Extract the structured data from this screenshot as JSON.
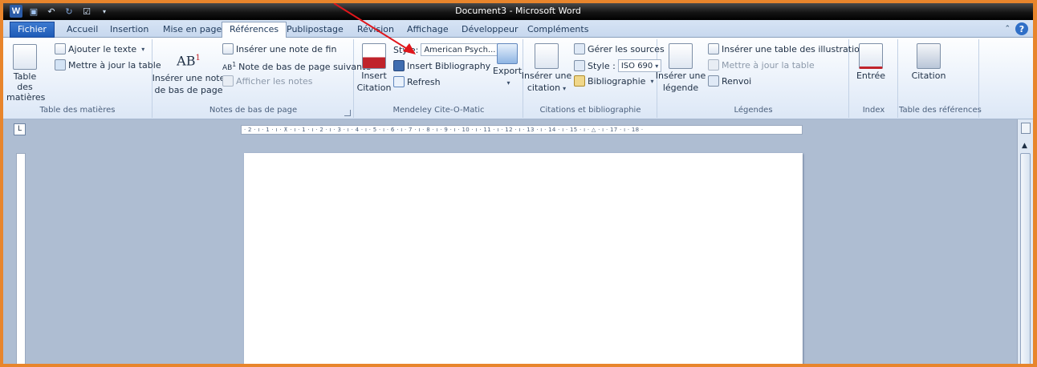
{
  "window": {
    "title": "Document3 - Microsoft Word"
  },
  "tabs": [
    {
      "label": "Fichier"
    },
    {
      "label": "Accueil"
    },
    {
      "label": "Insertion"
    },
    {
      "label": "Mise en page"
    },
    {
      "label": "Références"
    },
    {
      "label": "Publipostage"
    },
    {
      "label": "Révision"
    },
    {
      "label": "Affichage"
    },
    {
      "label": "Développeur"
    },
    {
      "label": "Compléments"
    }
  ],
  "groups": {
    "toc": {
      "label": "Table des matières",
      "table_btn": "Table des matières",
      "add_text": "Ajouter le texte",
      "update_table": "Mettre à jour la table"
    },
    "footnotes": {
      "label": "Notes de bas de page",
      "insert_footnote_l1": "Insérer une note",
      "insert_footnote_l2": "de bas de page",
      "insert_endnote": "Insérer une note de fin",
      "next_footnote": "Note de bas de page suivante",
      "show_notes": "Afficher les notes",
      "ab_glyph": "AB"
    },
    "mendeley": {
      "label": "Mendeley Cite-O-Matic",
      "insert_citation_l1": "Insert",
      "insert_citation_l2": "Citation",
      "style_label": "Style:",
      "style_value": "American Psych...",
      "insert_bibliography": "Insert Bibliography",
      "refresh": "Refresh",
      "export": "Export"
    },
    "citations": {
      "label": "Citations et bibliographie",
      "insert_citation_l1": "Insérer une",
      "insert_citation_l2": "citation",
      "manage_sources": "Gérer les sources",
      "style_label": "Style :",
      "style_value": "ISO 690",
      "bibliography": "Bibliographie"
    },
    "captions": {
      "label": "Légendes",
      "insert_caption_l1": "Insérer une",
      "insert_caption_l2": "légende",
      "insert_table_figures": "Insérer une table des illustrations",
      "update_table": "Mettre à jour la table",
      "cross_reference": "Renvoi"
    },
    "index": {
      "label": "Index",
      "entry": "Entrée"
    },
    "authorities": {
      "label": "Table des références",
      "citation": "Citation"
    }
  },
  "ruler": {
    "marks": "· 2 · ı · 1 · ı · ⊼ · ı · 1 · ı · 2 · ı · 3 · ı · 4 · ı · 5 · ı · 6 · ı · 7 · ı · 8 · ı · 9 · ı · 10 · ı · 11 · ı · 12 · ı · 13 · ı · 14 · ı · 15 · ı · △ · ı · 17 · ı · 18 ·"
  },
  "colors": {
    "frame_border": "#e8852c",
    "annotation_arrow": "#e0161b",
    "file_tab": "#2a66c2"
  }
}
